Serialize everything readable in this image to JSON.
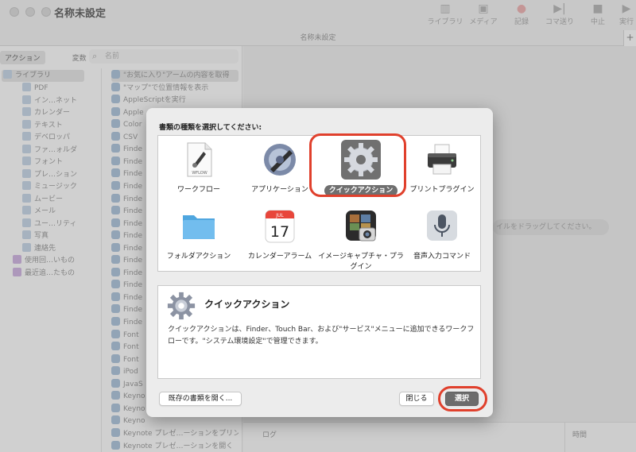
{
  "window": {
    "title": "名称未設定",
    "subtitle": "名称未設定",
    "toolbar": [
      "ライブラリ",
      "メディア",
      "記録",
      "コマ送り",
      "中止",
      "実行"
    ]
  },
  "left_pane": {
    "tabs": [
      "アクション",
      "変数"
    ],
    "search_placeholder": "名前",
    "library": [
      "ライブラリ",
      "PDF",
      "イン…ネット",
      "カレンダー",
      "テキスト",
      "デベロッパ",
      "ファ…ォルダ",
      "フォント",
      "プレ…ション",
      "ミュージック",
      "ムービー",
      "メール",
      "ユー…リティ",
      "写真",
      "連絡先",
      "使用回…いもの",
      "最近追…たもの"
    ],
    "actions": [
      "\"お気に入り\"アームの内容を取得",
      "\"マップ\"で位置情報を表示",
      "AppleScriptを実行",
      "Apple",
      "Color",
      "CSV",
      "Finde",
      "Finde",
      "Finde",
      "Finde",
      "Finde",
      "Finde",
      "Finde",
      "Finde",
      "Finde",
      "Finde",
      "Finde",
      "Finde",
      "Finde",
      "Finde",
      "Finde",
      "Font",
      "Font",
      "Font",
      "iPod",
      "JavaS",
      "Keyno",
      "Keyno",
      "Keyno",
      "Keynote プレゼ…ーションをプリント",
      "Keynote プレゼ…ーションを開く"
    ]
  },
  "right_pane": {
    "drag_hint": "イルをドラッグしてください。",
    "log_label": "ログ",
    "time_label": "時間"
  },
  "dialog": {
    "prompt": "書類の種類を選択してください:",
    "types": [
      {
        "label": "ワークフロー",
        "icon": "workflow-file-icon",
        "badge": "WFLOW"
      },
      {
        "label": "アプリケーション",
        "icon": "automator-app-icon"
      },
      {
        "label": "クイックアクション",
        "icon": "gear-icon",
        "selected": true
      },
      {
        "label": "プリントプラグイン",
        "icon": "printer-icon"
      },
      {
        "label": "フォルダアクション",
        "icon": "folder-icon"
      },
      {
        "label": "カレンダーアラーム",
        "icon": "calendar-icon",
        "month": "JUL",
        "day": "17"
      },
      {
        "label": "イメージキャプチャ・プラグイン",
        "icon": "image-capture-icon"
      },
      {
        "label": "音声入力コマンド",
        "icon": "microphone-icon"
      }
    ],
    "description": {
      "title": "クイックアクション",
      "text": "クイックアクションは、Finder、Touch Bar、および\"サービス\"メニューに追加できるワークフローです。\"システム環境設定\"で管理できます。"
    },
    "buttons": {
      "open_existing": "既存の書類を開く...",
      "close": "閉じる",
      "choose": "選択"
    },
    "highlight_color": "#e0402c"
  }
}
